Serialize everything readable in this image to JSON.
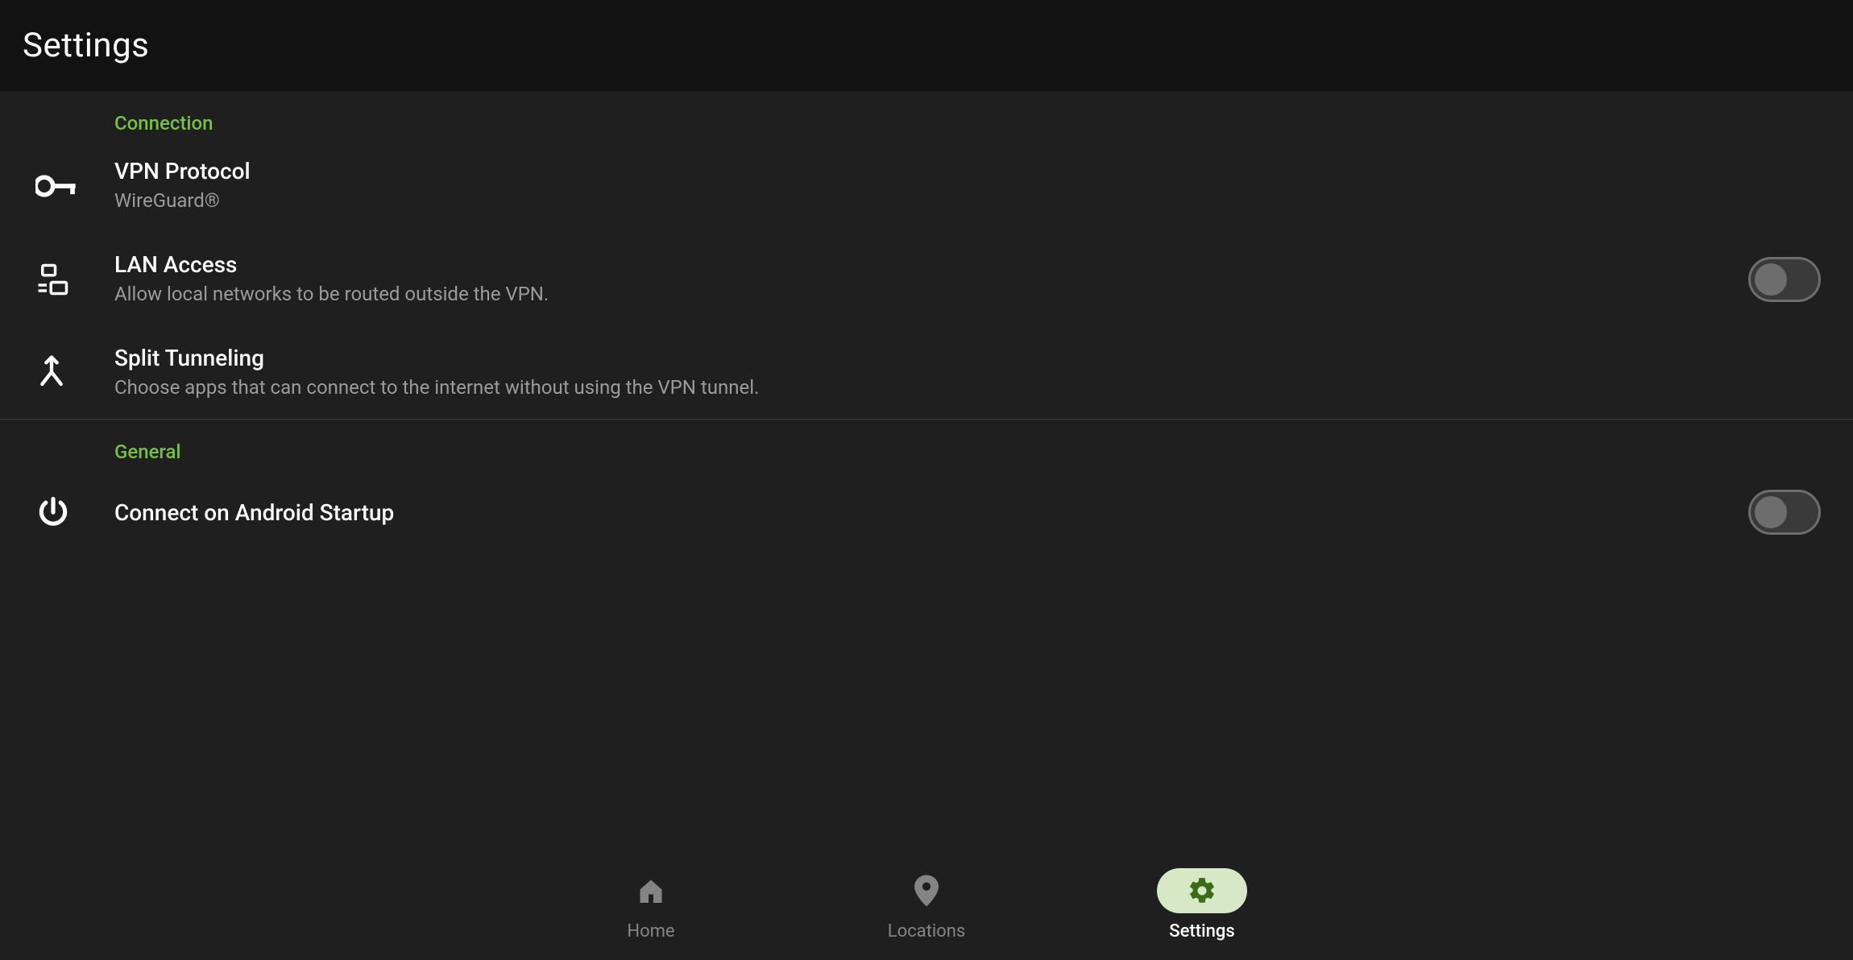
{
  "header": {
    "title": "Settings"
  },
  "sections": {
    "connection": {
      "label": "Connection",
      "vpn_protocol": {
        "title": "VPN Protocol",
        "value": "WireGuard®"
      },
      "lan_access": {
        "title": "LAN Access",
        "desc": "Allow local networks to be routed outside the VPN.",
        "enabled": false
      },
      "split_tunneling": {
        "title": "Split Tunneling",
        "desc": "Choose apps that can connect to the internet without using the VPN tunnel."
      }
    },
    "general": {
      "label": "General",
      "connect_on_startup": {
        "title": "Connect on Android Startup",
        "enabled": false
      }
    }
  },
  "nav": {
    "home": "Home",
    "locations": "Locations",
    "settings": "Settings",
    "active": "settings"
  }
}
